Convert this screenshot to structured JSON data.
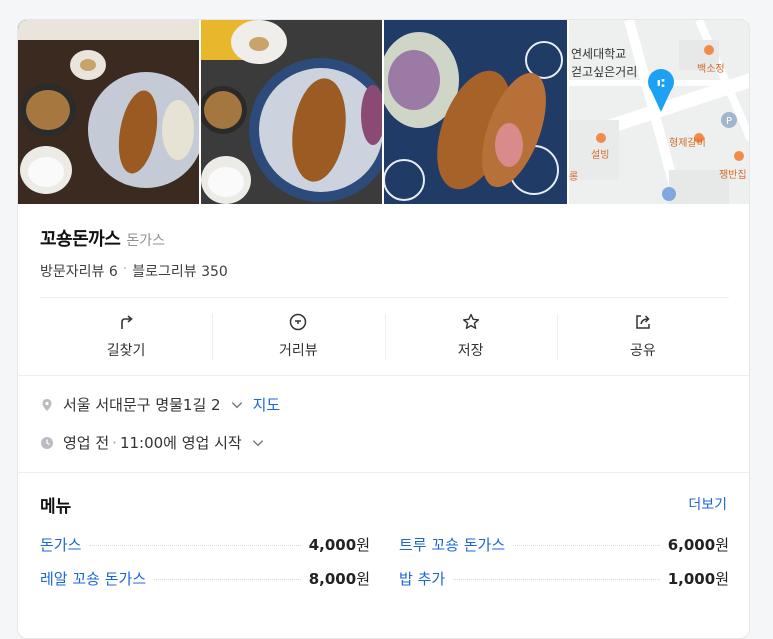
{
  "place": {
    "name": "꼬숑돈까스",
    "category": "돈가스",
    "visitor_reviews": "방문자리뷰 6",
    "separator": "·",
    "blog_reviews": "블로그리뷰 350"
  },
  "map_labels": {
    "university": "연세대학교",
    "district": "걷고싶은거리",
    "restaurant_a": "백소정",
    "restaurant_b": "형제갈비",
    "restaurant_c": "설빙",
    "restaurant_d": "쟁반집",
    "restaurant_e": "롱"
  },
  "actions": [
    {
      "label": "길찾기",
      "icon": "directions-icon"
    },
    {
      "label": "거리뷰",
      "icon": "streetview-icon"
    },
    {
      "label": "저장",
      "icon": "star-icon"
    },
    {
      "label": "공유",
      "icon": "share-icon"
    }
  ],
  "address": {
    "text": "서울 서대문구 명물1길 2",
    "map_link": "지도"
  },
  "hours": {
    "status": "영업 전",
    "separator": "·",
    "detail": "11:00에 영업 시작"
  },
  "menu": {
    "title": "메뉴",
    "more": "더보기",
    "items": [
      {
        "name": "돈가스",
        "price": "4,000",
        "unit": "원"
      },
      {
        "name": "트루 꼬숑 돈가스",
        "price": "6,000",
        "unit": "원"
      },
      {
        "name": "레알 꼬숑 돈가스",
        "price": "8,000",
        "unit": "원"
      },
      {
        "name": "밥 추가",
        "price": "1,000",
        "unit": "원"
      }
    ]
  },
  "colors": {
    "link": "#1b64da",
    "map_pin": "#1ea1f2",
    "poi": "#f28b4a"
  }
}
